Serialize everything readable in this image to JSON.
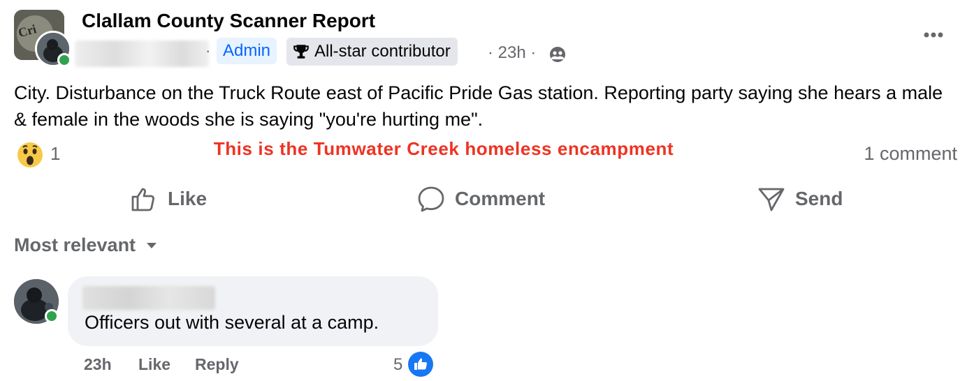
{
  "post": {
    "group_name": "Clallam County Scanner Report",
    "separator": "·",
    "admin_badge": "Admin",
    "contributor_badge": "All-star contributor",
    "time": "· 23h ·",
    "text": "City. Disturbance on the Truck Route east of Pacific Pride Gas station. Reporting  party saying she hears a male & female in the woods she is saying \"you're hurting me\".",
    "reaction_count": "1",
    "annotation": "This is the Tumwater Creek homeless encampment",
    "comment_count": "1 comment"
  },
  "actions": {
    "like": "Like",
    "comment": "Comment",
    "send": "Send"
  },
  "comments": {
    "sort_label": "Most relevant",
    "items": [
      {
        "text": "Officers out with several at a camp.",
        "time": "23h",
        "like": "Like",
        "reply": "Reply",
        "likes": "5"
      }
    ]
  },
  "colors": {
    "accent": "#0866ff",
    "annotation": "#ee3322",
    "online": "#31a24c",
    "meta": "#65676b"
  },
  "icons": [
    "more-icon",
    "trophy-icon",
    "audience-icon",
    "wow-reaction-icon",
    "thumbs-up-icon",
    "comment-icon",
    "send-icon",
    "dropdown-icon",
    "like-reaction-icon"
  ]
}
